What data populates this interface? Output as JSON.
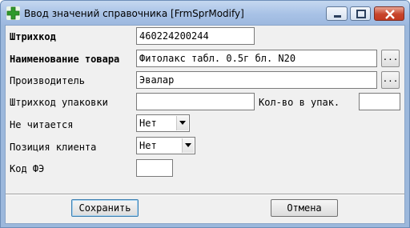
{
  "window": {
    "title": "Ввод значений справочника [FrmSprModify]",
    "icons": {
      "app": "green-cross-icon",
      "minimize": "minimize-icon",
      "maximize": "maximize-icon",
      "close": "close-icon"
    }
  },
  "form": {
    "barcode": {
      "label": "Штрихкод",
      "value": "460224200244"
    },
    "product_name": {
      "label": "Наименование товара",
      "value": "Фитолакс табл. 0.5г бл. N20",
      "browse_label": "..."
    },
    "manufacturer": {
      "label": "Производитель",
      "value": "Эвалар",
      "browse_label": "..."
    },
    "package_barcode": {
      "label": "Штрихкод упаковки",
      "value": ""
    },
    "qty_in_package": {
      "label": "Кол-во в упак.",
      "value": ""
    },
    "unreadable": {
      "label": "Не читается",
      "selected": "Нет"
    },
    "client_position": {
      "label": "Позиция клиента",
      "selected": "Нет"
    },
    "fe_code": {
      "label": "Код ФЭ",
      "value": ""
    }
  },
  "buttons": {
    "save": "Сохранить",
    "cancel": "Отмена"
  }
}
